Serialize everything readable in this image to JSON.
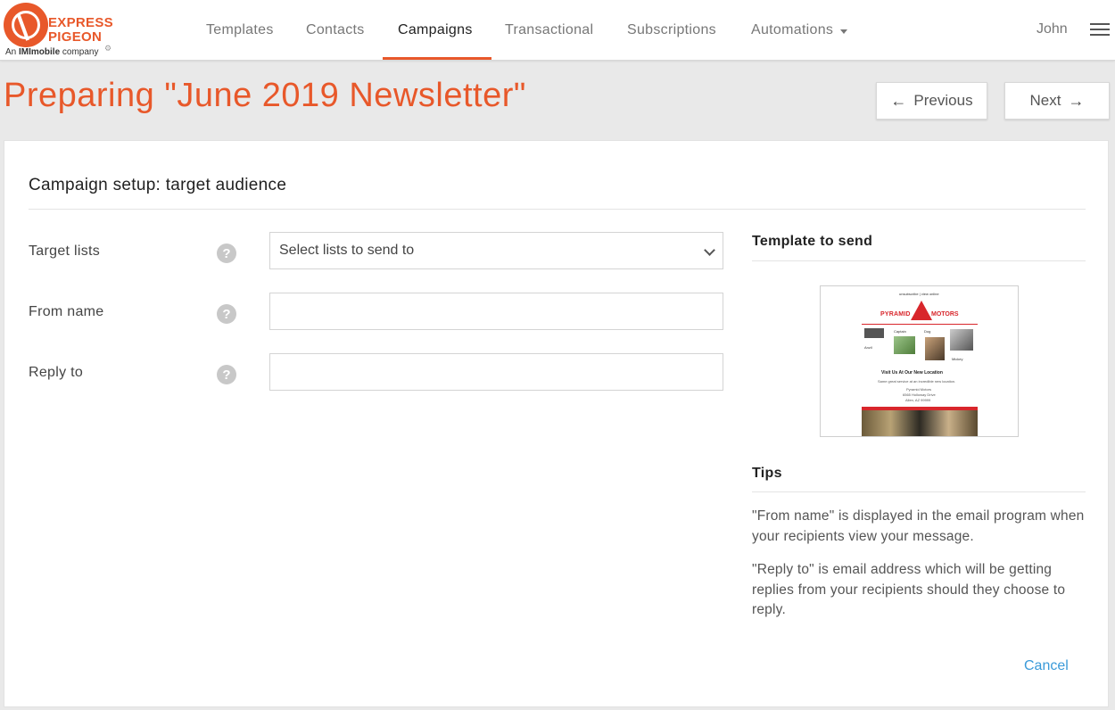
{
  "brand": {
    "logo_word_1": "EXPRESS",
    "logo_word_2": "PIGEON",
    "tagline_prefix": "An ",
    "tagline_bold": "IMImobile",
    "tagline_suffix": " company",
    "accent_color": "#e8582a"
  },
  "nav": {
    "items": [
      {
        "label": "Templates"
      },
      {
        "label": "Contacts"
      },
      {
        "label": "Campaigns",
        "active": true
      },
      {
        "label": "Transactional"
      },
      {
        "label": "Subscriptions"
      },
      {
        "label": "Automations",
        "dropdown": true
      }
    ],
    "user_name": "John"
  },
  "header": {
    "title": "Preparing \"June 2019 Newsletter\"",
    "previous_label": "Previous",
    "next_label": "Next"
  },
  "form": {
    "section_title": "Campaign setup: target audience",
    "target_lists": {
      "label": "Target lists",
      "placeholder": "Select lists to send to"
    },
    "from_name": {
      "label": "From name",
      "value": ""
    },
    "reply_to": {
      "label": "Reply to",
      "value": ""
    },
    "help_glyph": "?"
  },
  "sidebar": {
    "template_title": "Template to send",
    "template_preview": {
      "top_text": "unsubscribe | view online",
      "brand_left": "PYRAMID",
      "brand_right": "MOTORS",
      "caption_1": "Captain",
      "caption_2": "Dog",
      "caption_3": "Anzil",
      "caption_4": "Mickey",
      "headline": "Visit Us At Our New Location",
      "text": "Same great service at an incredible new location.",
      "addr_1": "Pyramid Motors",
      "addr_2": "6565 Holloway Drive",
      "addr_3": "Allen, AZ 99999"
    },
    "tips_title": "Tips",
    "tips": [
      "\"From name\" is displayed in the email program when your recipients view your message.",
      "\"Reply to\" is email address which will be getting replies from your recipients should they choose to reply."
    ]
  },
  "footer": {
    "cancel_label": "Cancel"
  },
  "icons": {
    "arrow_left": "←",
    "arrow_right": "→",
    "menu": "hamburger-icon",
    "settings": "⚙"
  }
}
